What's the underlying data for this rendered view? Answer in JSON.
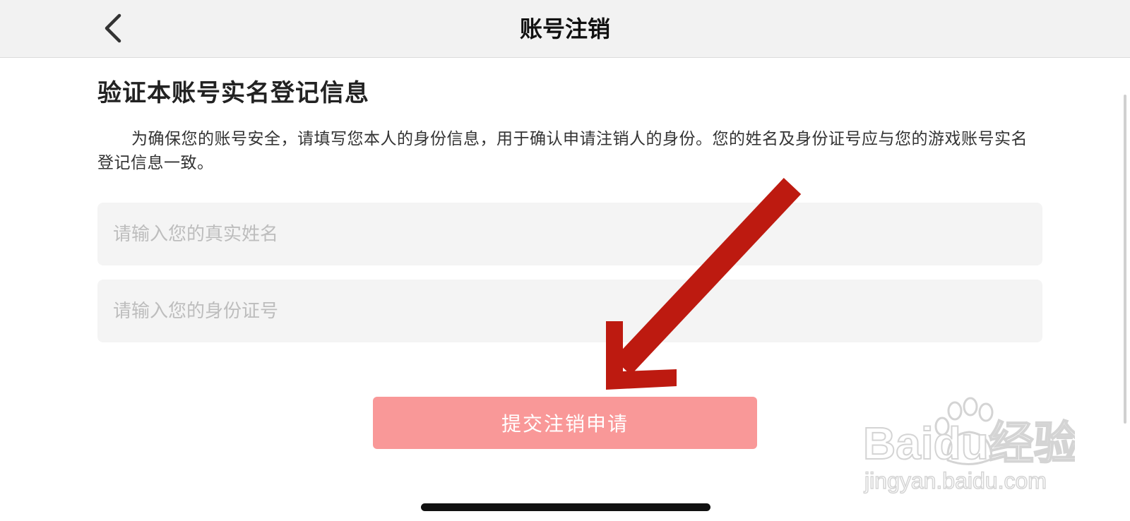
{
  "navbar": {
    "title": "账号注销",
    "back_icon": "chevron-left-icon"
  },
  "main": {
    "section_title": "验证本账号实名登记信息",
    "description": "为确保您的账号安全，请填写您本人的身份信息，用于确认申请注销人的身份。您的姓名及身份证号应与您的游戏账号实名登记信息一致。",
    "name_field": {
      "value": "",
      "placeholder": "请输入您的真实姓名"
    },
    "id_field": {
      "value": "",
      "placeholder": "请输入您的身份证号"
    },
    "submit_label": "提交注销申请"
  },
  "overlay": {
    "arrow_color": "#bd1a10"
  },
  "watermark": {
    "brand": "Baidu经验",
    "url": "jingyan.baidu.com"
  },
  "colors": {
    "submit_button": "#f99898",
    "navbar_bg": "#f2f2f2",
    "field_bg": "#f4f4f4"
  }
}
